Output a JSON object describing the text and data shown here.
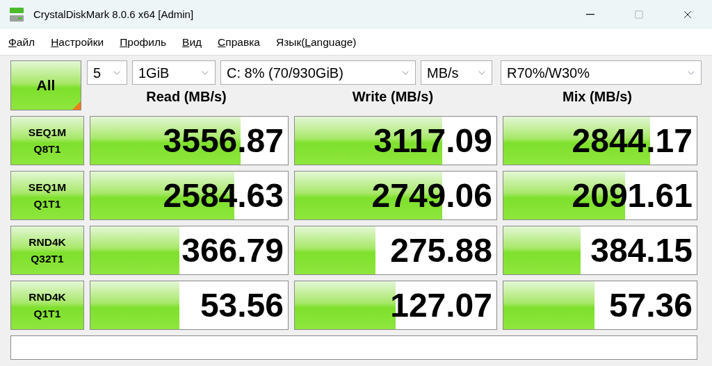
{
  "window": {
    "title": "CrystalDiskMark 8.0.6 x64 [Admin]"
  },
  "menu": [
    {
      "key": "Ф",
      "after": "айл"
    },
    {
      "key": "Н",
      "after": "астройки"
    },
    {
      "key": "П",
      "after": "рофиль"
    },
    {
      "key": "В",
      "after": "ид"
    },
    {
      "key": "С",
      "after": "правка"
    },
    {
      "before": "Язык(",
      "key": "L",
      "after": "anguage)"
    }
  ],
  "all_button": "All",
  "selects": [
    {
      "value": "5"
    },
    {
      "value": "1GiB"
    },
    {
      "value": "C: 8% (70/930GiB)"
    },
    {
      "value": "MB/s"
    },
    {
      "value": "R70%/W30%"
    }
  ],
  "columns": [
    "Read (MB/s)",
    "Write (MB/s)",
    "Mix (MB/s)"
  ],
  "rows": [
    {
      "test": [
        "SEQ1M",
        "Q8T1"
      ],
      "results": [
        {
          "value": "3556.87",
          "level": 0.76
        },
        {
          "value": "3117.09",
          "level": 0.73
        },
        {
          "value": "2844.17",
          "level": 0.76
        }
      ]
    },
    {
      "test": [
        "SEQ1M",
        "Q1T1"
      ],
      "results": [
        {
          "value": "2584.63",
          "level": 0.73
        },
        {
          "value": "2749.06",
          "level": 0.73
        },
        {
          "value": "2091.61",
          "level": 0.63
        }
      ]
    },
    {
      "test": [
        "RND4K",
        "Q32T1"
      ],
      "results": [
        {
          "value": "366.79",
          "level": 0.45
        },
        {
          "value": "275.88",
          "level": 0.4
        },
        {
          "value": "384.15",
          "level": 0.4
        }
      ]
    },
    {
      "test": [
        "RND4K",
        "Q1T1"
      ],
      "results": [
        {
          "value": "53.56",
          "level": 0.45
        },
        {
          "value": "127.07",
          "level": 0.5
        },
        {
          "value": "57.36",
          "level": 0.47
        }
      ]
    }
  ]
}
